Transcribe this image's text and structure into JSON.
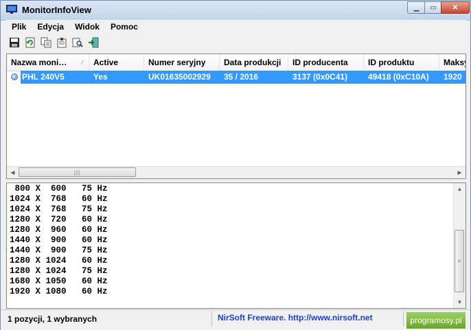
{
  "window": {
    "title": "MonitorInfoView"
  },
  "menu": [
    "Plik",
    "Edycja",
    "Widok",
    "Pomoc"
  ],
  "toolbar": [
    "save-icon",
    "refresh-icon",
    "copy-icon",
    "properties-icon",
    "find-icon",
    "exit-icon"
  ],
  "columns": [
    "Nazwa moni…",
    "Active",
    "Numer seryjny",
    "Data produkcji",
    "ID producenta",
    "ID produktu",
    "Maksy"
  ],
  "row": [
    "PHL 240V5",
    "Yes",
    "UK01635002929",
    "35 / 2016",
    "3137 (0x0C41)",
    "49418 (0xC10A)",
    "1920"
  ],
  "modes": [
    " 800 X  600   75 Hz",
    "1024 X  768   60 Hz",
    "1024 X  768   75 Hz",
    "1280 X  720   60 Hz",
    "1280 X  960   60 Hz",
    "1440 X  900   60 Hz",
    "1440 X  900   75 Hz",
    "1280 X 1024   60 Hz",
    "1280 X 1024   75 Hz",
    "1680 X 1050   60 Hz",
    "1920 X 1080   60 Hz"
  ],
  "status": {
    "count": "1 pozycji, 1 wybranych",
    "link": "NirSoft Freeware.  http://www.nirsoft.net",
    "brand": "programosy.pl"
  },
  "colors": {
    "selection": "#3399ff",
    "link": "#1b3fd0",
    "brand": "#7db842"
  }
}
